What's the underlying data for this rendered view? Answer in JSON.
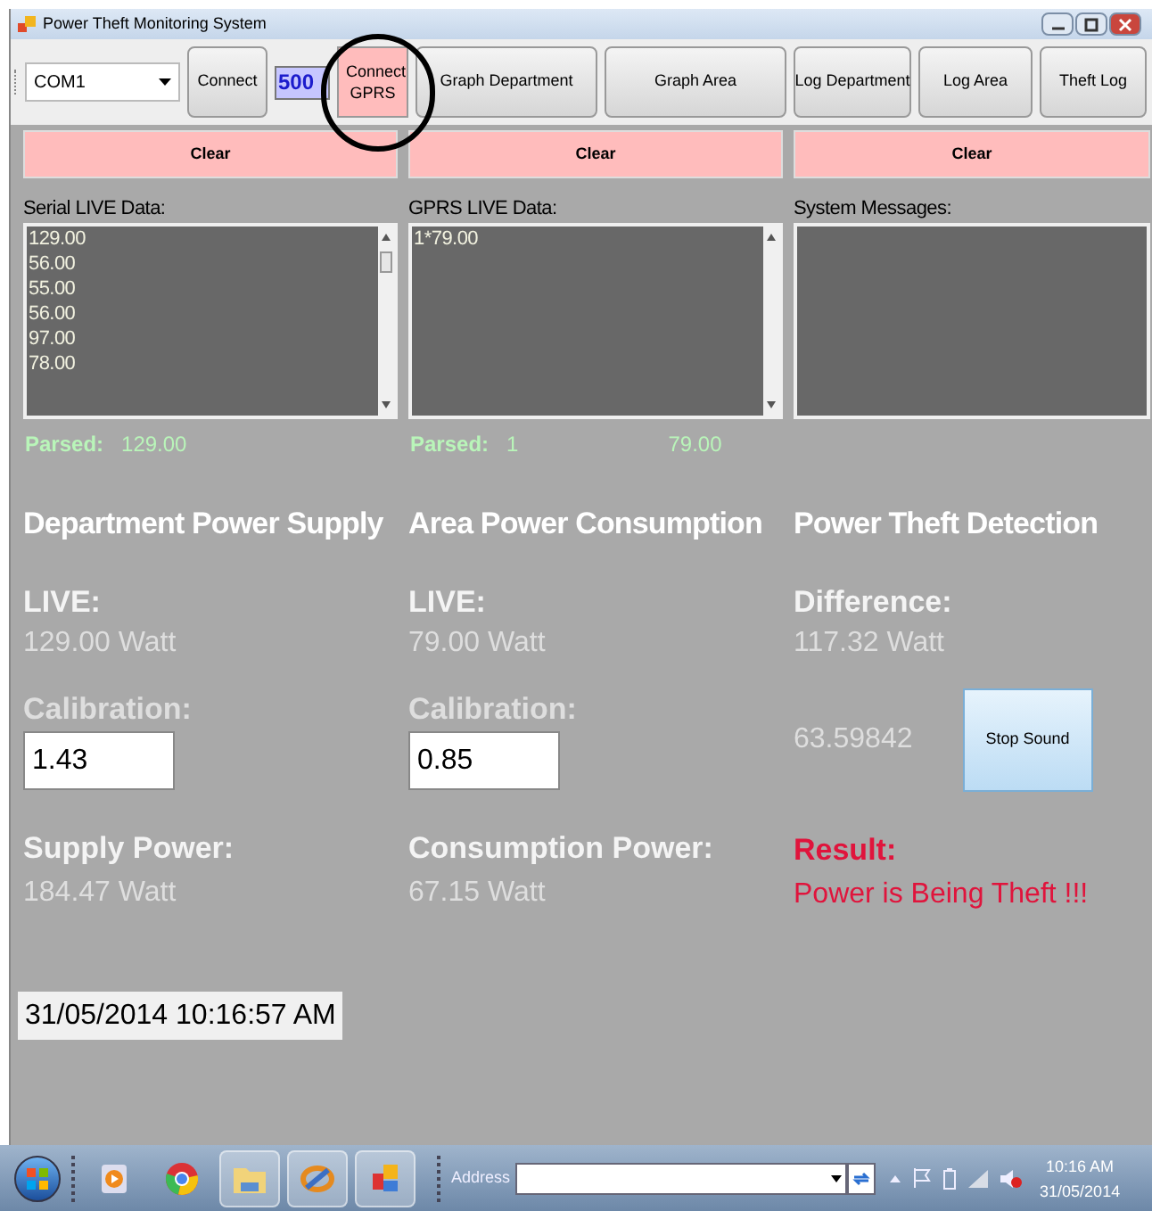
{
  "window": {
    "title": "Power Theft Monitoring System"
  },
  "toolbar": {
    "port_select": {
      "value": "COM1"
    },
    "connect_button": "Connect",
    "port_field": {
      "value": "500"
    },
    "gprs_button": "Connect GPRS",
    "nav_buttons": [
      "Graph Department",
      "Graph Area",
      "Log Department",
      "Log Area",
      "Theft Log"
    ]
  },
  "columns": [
    {
      "kind": "calibration",
      "clear_button": "Clear",
      "list_label": "Serial LIVE Data:",
      "list_items": [
        "129.00",
        "56.00",
        "55.00",
        "56.00",
        "97.00",
        "78.00"
      ],
      "has_scrollbar_thumb": true,
      "parsed": [
        "Parsed:",
        "129.00"
      ],
      "heading": "Department Power Supply",
      "live_label": "LIVE:",
      "live_value": "129.00 Watt",
      "middle_label": "Calibration:",
      "middle_value": "1.43",
      "result_label": "Supply Power:",
      "result_value": "184.47 Watt"
    },
    {
      "kind": "calibration",
      "clear_button": "Clear",
      "list_label": "GPRS LIVE Data:",
      "list_items": [
        "1*79.00"
      ],
      "has_scrollbar_thumb": false,
      "parsed": [
        "Parsed:",
        "1",
        "79.00"
      ],
      "heading": "Area Power Consumption",
      "live_label": "LIVE:",
      "live_value": "79.00 Watt",
      "middle_label": "Calibration:",
      "middle_value": "0.85",
      "result_label": "Consumption Power:",
      "result_value": "67.15 Watt"
    },
    {
      "kind": "alarm",
      "clear_button": "Clear",
      "list_label": "System Messages:",
      "heading": "Power Theft Detection",
      "live_label": "Difference:",
      "live_value": "117.32 Watt",
      "middle_value": "63.59842",
      "stop_button": "Stop Sound",
      "result_label": "Result:",
      "result_value": "Power is Being Theft !!!"
    }
  ],
  "datetime": "31/05/2014 10:16:57 AM",
  "taskbar": {
    "address_label": "Address",
    "clock_time": "10:16 AM",
    "clock_date": "31/05/2014"
  }
}
